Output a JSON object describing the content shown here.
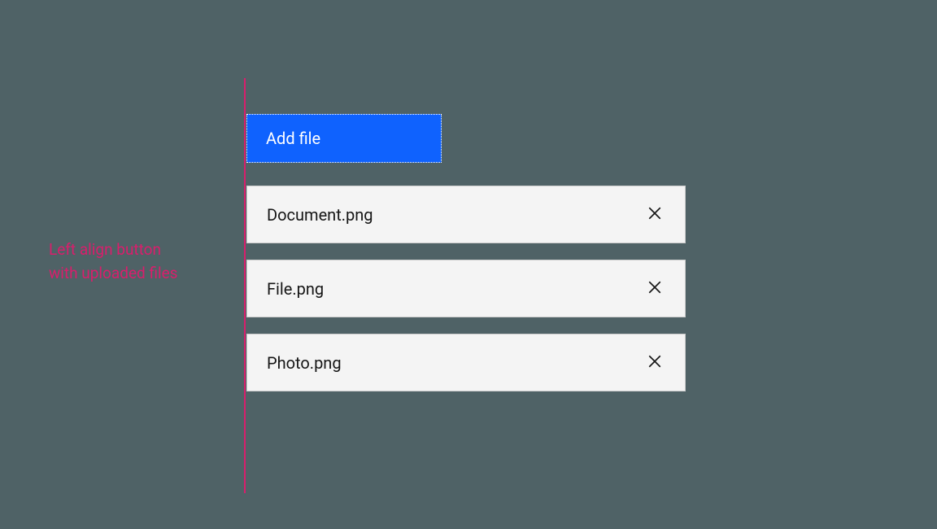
{
  "annotation": {
    "line1": "Left align button",
    "line2": "with uploaded files"
  },
  "button": {
    "add_file_label": "Add file"
  },
  "files": [
    {
      "name": "Document.png"
    },
    {
      "name": "File.png"
    },
    {
      "name": "Photo.png"
    }
  ],
  "colors": {
    "accent": "#d91e6c",
    "primary": "#0f62fe",
    "background": "#4f6266",
    "file_bg": "#f4f4f4"
  }
}
